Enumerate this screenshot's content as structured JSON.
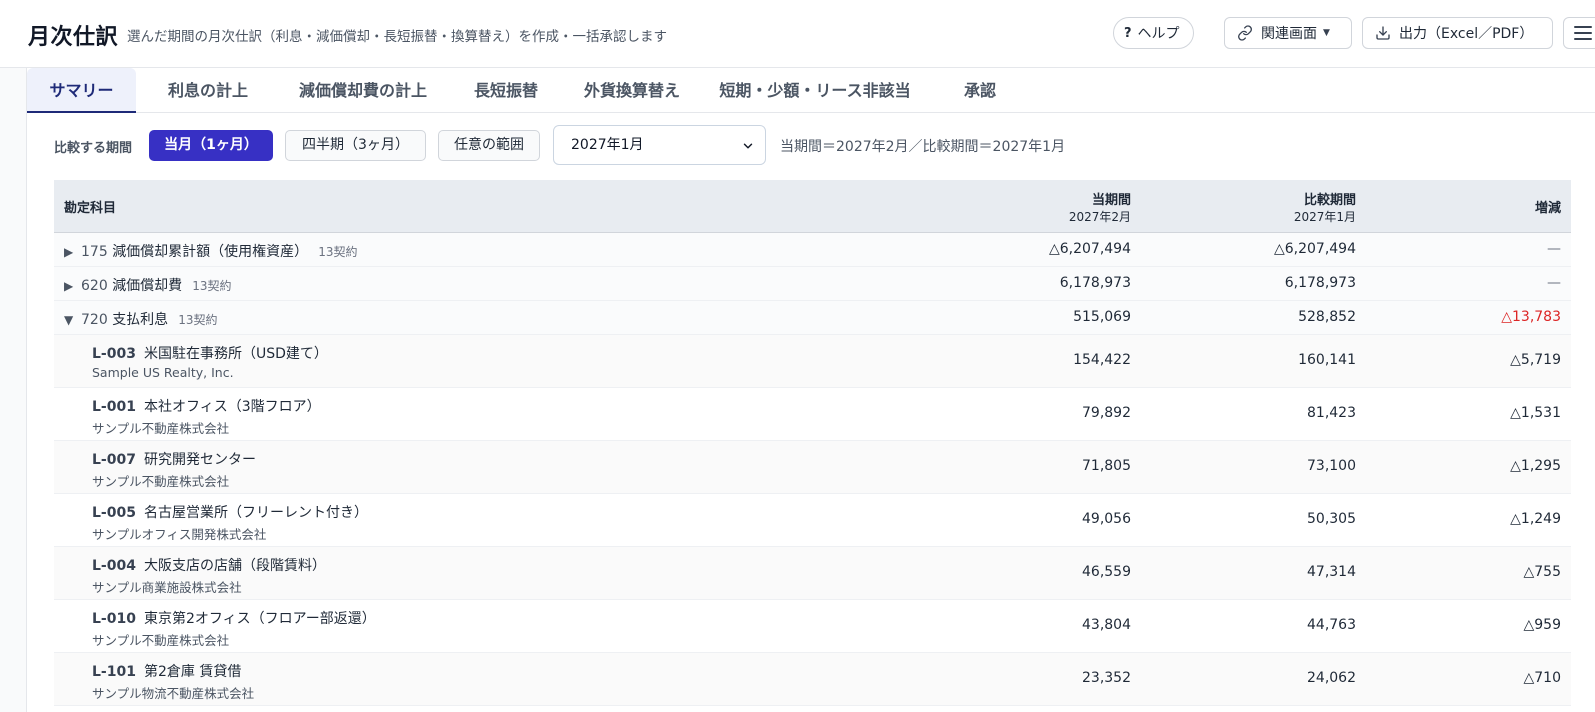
{
  "header": {
    "title": "月次仕訳",
    "subtitle": "選んだ期間の月次仕訳（利息・減価償却・長短振替・換算替え）を作成・一括承認します",
    "help_label": "ヘルプ",
    "related_label": "関連画面",
    "export_label": "出力（Excel／PDF）"
  },
  "tabs": [
    {
      "label": "サマリー",
      "active": true
    },
    {
      "label": "利息の計上",
      "active": false
    },
    {
      "label": "減価償却費の計上",
      "active": false
    },
    {
      "label": "長短振替",
      "active": false
    },
    {
      "label": "外貨換算替え",
      "active": false
    },
    {
      "label": "短期・少額・リース非該当",
      "active": false
    },
    {
      "label": "承認",
      "active": false
    }
  ],
  "filter": {
    "label": "比較する期間",
    "options": [
      {
        "label": "当月（1ヶ月）",
        "active": true
      },
      {
        "label": "四半期（3ヶ月）",
        "active": false
      },
      {
        "label": "任意の範囲",
        "active": false
      }
    ],
    "selected_month": "2027年1月",
    "period_info": "当期間＝2027年2月／比較期間＝2027年1月"
  },
  "table": {
    "headers": {
      "account": "勘定科目",
      "current": "当期間",
      "current_sub": "2027年2月",
      "compare": "比較期間",
      "compare_sub": "2027年1月",
      "diff": "増減"
    },
    "groups": [
      {
        "expanded": false,
        "code": "175",
        "name": "減価償却累計額（使用権資産）",
        "count": "13契約",
        "current": "△6,207,494",
        "compare": "△6,207,494",
        "diff": "—",
        "diff_style": "dash"
      },
      {
        "expanded": false,
        "code": "620",
        "name": "減価償却費",
        "count": "13契約",
        "current": "6,178,973",
        "compare": "6,178,973",
        "diff": "—",
        "diff_style": "dash"
      },
      {
        "expanded": true,
        "code": "720",
        "name": "支払利息",
        "count": "13契約",
        "current": "515,069",
        "compare": "528,852",
        "diff": "△13,783",
        "diff_style": "neg"
      }
    ],
    "details": [
      {
        "id": "L-003",
        "name": "米国駐在事務所（USD建て）",
        "lessor": "Sample US Realty, Inc.",
        "current": "154,422",
        "compare": "160,141",
        "diff": "△5,719"
      },
      {
        "id": "L-001",
        "name": "本社オフィス（3階フロア）",
        "lessor": "サンプル不動産株式会社",
        "current": "79,892",
        "compare": "81,423",
        "diff": "△1,531"
      },
      {
        "id": "L-007",
        "name": "研究開発センター",
        "lessor": "サンプル不動産株式会社",
        "current": "71,805",
        "compare": "73,100",
        "diff": "△1,295"
      },
      {
        "id": "L-005",
        "name": "名古屋営業所（フリーレント付き）",
        "lessor": "サンプルオフィス開発株式会社",
        "current": "49,056",
        "compare": "50,305",
        "diff": "△1,249"
      },
      {
        "id": "L-004",
        "name": "大阪支店の店舗（段階賃料）",
        "lessor": "サンプル商業施設株式会社",
        "current": "46,559",
        "compare": "47,314",
        "diff": "△755"
      },
      {
        "id": "L-010",
        "name": "東京第2オフィス（フロアー部返還）",
        "lessor": "サンプル不動産株式会社",
        "current": "43,804",
        "compare": "44,763",
        "diff": "△959"
      },
      {
        "id": "L-101",
        "name": "第2倉庫 賃貸借",
        "lessor": "サンプル物流不動産株式会社",
        "current": "23,352",
        "compare": "24,062",
        "diff": "△710"
      }
    ]
  },
  "icons": {
    "related": "link-icon",
    "export": "download-icon",
    "menu": "hamburger-icon",
    "select": "chevron-down-icon"
  },
  "colors": {
    "accent": "#3730c4",
    "tab_active": "#1e2a78",
    "negative": "#dc2626"
  }
}
